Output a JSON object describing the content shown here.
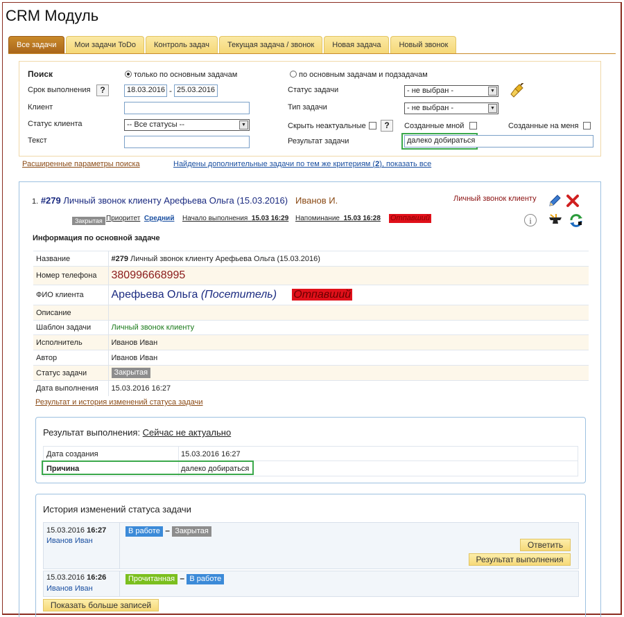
{
  "app": {
    "title": "CRM Модуль"
  },
  "tabs": [
    "Все задачи",
    "Мои задачи ToDo",
    "Контроль задач",
    "Текущая задача / звонок",
    "Новая задача",
    "Новый звонок"
  ],
  "search": {
    "heading": "Поиск",
    "radio_main": "только по основным задачам",
    "radio_sub": "по основным задачам и подзадачам",
    "deadline_label": "Срок выполнения",
    "help": "?",
    "date_from": "18.03.2016",
    "date_sep": "-",
    "date_to": "25.03.2016",
    "client_label": "Клиент",
    "client_status_label": "Статус клиента",
    "client_status_value": "-- Все статусы --",
    "text_label": "Текст",
    "task_status_label": "Статус задачи",
    "task_status_value": "- не выбран -",
    "task_type_label": "Тип задачи",
    "task_type_value": "- не выбран -",
    "hide_label": "Скрыть неактуальные",
    "created_by_me_label": "Созданные мной",
    "created_for_me_label": "Созданные на меня",
    "result_label": "Результат задачи",
    "result_value": "далеко добираться",
    "advanced_link": "Расширенные параметры поиска",
    "found_prefix": "Найдены дополнительные задачи по тем же критериям (",
    "found_count": "2",
    "found_suffix": "), показать все"
  },
  "task": {
    "index": "1.",
    "number": "#279",
    "title": "Личный звонок клиенту Арефьева Ольга (15.03.2016)",
    "assignee": "Иванов И.",
    "type": "Личный звонок клиенту",
    "status_badge": "Закрытая",
    "priority_label": "Приоритет",
    "priority_value": "Средний",
    "start_label": "Начало выполнения",
    "start_value": "15.03 16:29",
    "reminder_label": "Напоминание",
    "reminder_value": "15.03 16:28",
    "client_tag": "Отпавший",
    "info_heading": "Информация по основной задаче",
    "rows": {
      "name_label": "Название",
      "name_num": "#279",
      "name_text": " Личный звонок клиенту Арефьева Ольга (15.03.2016)",
      "phone_label": "Номер телефона",
      "phone": "380996668995",
      "fio_label": "ФИО клиента",
      "fio": "Арефьева Ольга",
      "fio_type": "(Посетитель)",
      "fio_tag": "Отпавший",
      "desc_label": "Описание",
      "template_label": "Шаблон задачи",
      "template": "Личный звонок клиенту",
      "executor_label": "Исполнитель",
      "executor": "Иванов Иван",
      "author_label": "Автор",
      "author": "Иванов Иван",
      "status_label": "Статус задачи",
      "status": "Закрытая",
      "date_label": "Дата выполнения",
      "date": "15.03.2016 16:27"
    },
    "history_link": "Результат и история изменений статуса задачи"
  },
  "result": {
    "title_prefix": "Результат выполнения: ",
    "title_value": "Сейчас не актуально",
    "created_label": "Дата создания",
    "created": "15.03.2016 16:27",
    "reason_label": "Причина",
    "reason": "далеко добираться"
  },
  "history": {
    "title": "История изменений статуса задачи",
    "entries": [
      {
        "date": "15.03.2016",
        "time": "16:27",
        "user": "Иванов Иван",
        "from": "В работе",
        "to": "Закрытая"
      },
      {
        "date": "15.03.2016",
        "time": "16:26",
        "user": "Иванов Иван",
        "from": "Прочитанная",
        "to": "В работе"
      }
    ],
    "reply_button": "Ответить",
    "result_button": "Результат выполнения",
    "more_button": "Показать больше записей"
  },
  "colors": {
    "blue_badge": "#3b8ad8",
    "gray_badge": "#8d8d8d",
    "green_badge": "#7bbf1e",
    "red_tag": "#e0101a",
    "highlight_border": "#3aa84a"
  }
}
